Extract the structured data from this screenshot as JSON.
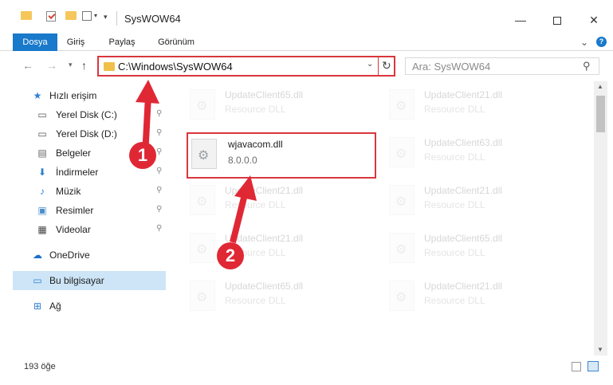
{
  "window": {
    "title": "SysWOW64",
    "min_glyph": "—",
    "close_glyph": "✕"
  },
  "ribbon": {
    "tabs": [
      "Dosya",
      "Giriş",
      "Paylaş",
      "Görünüm"
    ],
    "help": "?",
    "collapse_glyph": "⌄"
  },
  "nav": {
    "back": "←",
    "forward": "→",
    "recent": "▾",
    "up": "↑",
    "address": "C:\\Windows\\SysWOW64",
    "address_drop": "⌄",
    "refresh": "↻",
    "search_placeholder": "Ara: SysWOW64",
    "search_glyph": "⚲"
  },
  "sidebar": {
    "items": [
      {
        "label": "Hızlı erişim",
        "icon": "star-icon",
        "glyph": "★",
        "pinned": false
      },
      {
        "label": "Yerel Disk (C:)",
        "icon": "drive-icon",
        "glyph": "▭",
        "pinned": true
      },
      {
        "label": "Yerel Disk (D:)",
        "icon": "drive-icon",
        "glyph": "▭",
        "pinned": true
      },
      {
        "label": "Belgeler",
        "icon": "document-icon",
        "glyph": "▤",
        "pinned": true
      },
      {
        "label": "İndirmeler",
        "icon": "download-icon",
        "glyph": "⬇",
        "pinned": true
      },
      {
        "label": "Müzik",
        "icon": "music-icon",
        "glyph": "♪",
        "pinned": true
      },
      {
        "label": "Resimler",
        "icon": "pictures-icon",
        "glyph": "▣",
        "pinned": true
      },
      {
        "label": "Videolar",
        "icon": "video-icon",
        "glyph": "▦",
        "pinned": true
      },
      {
        "label": "OneDrive",
        "icon": "cloud-icon",
        "glyph": "☁",
        "pinned": false
      },
      {
        "label": "Bu bilgisayar",
        "icon": "computer-icon",
        "glyph": "▭",
        "pinned": false
      },
      {
        "label": "Ağ",
        "icon": "network-icon",
        "glyph": "⊞",
        "pinned": false
      }
    ],
    "pin_glyph": "⚲"
  },
  "files": {
    "highlighted": {
      "name": "wjavacom.dll",
      "desc": "8.0.0.0"
    },
    "left_column": [
      {
        "name": "UpdateClient65.dll",
        "desc": "Resource DLL"
      },
      {
        "name": "UpdateClient21.dll",
        "desc": "Resource DLL"
      },
      {
        "name": "UpdateClient21.dll",
        "desc": "Resource DLL"
      },
      {
        "name": "UpdateClient65.dll",
        "desc": "Resource DLL"
      }
    ],
    "right_column": [
      {
        "name": "UpdateClient21.dll",
        "desc": "Resource DLL"
      },
      {
        "name": "UpdateClient63.dll",
        "desc": "Resource DLL"
      },
      {
        "name": "UpdateClient21.dll",
        "desc": "Resource DLL"
      },
      {
        "name": "UpdateClient65.dll",
        "desc": "Resource DLL"
      },
      {
        "name": "UpdateClient21.dll",
        "desc": "Resource DLL"
      }
    ]
  },
  "scrollbar": {
    "up": "▲",
    "down": "▼"
  },
  "status": {
    "count": "193 öğe"
  },
  "annotations": {
    "step1": "1",
    "step2": "2",
    "color": "#e02835"
  }
}
